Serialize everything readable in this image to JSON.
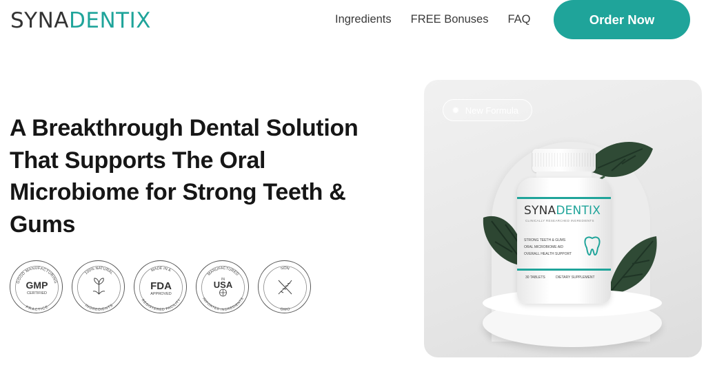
{
  "brand": {
    "name_part1": "SYNA",
    "name_part2": "DENTIX"
  },
  "nav": {
    "items": [
      {
        "label": "Ingredients"
      },
      {
        "label": "FREE Bonuses"
      },
      {
        "label": "FAQ"
      }
    ],
    "cta_label": "Order Now"
  },
  "hero": {
    "title": "A Breakthrough Dental Solution That Supports The Oral Microbiome for Strong Teeth & Gums"
  },
  "badges": [
    {
      "icon": "gmp-badge-icon",
      "main": "GMP",
      "sub": "CERTIFIED",
      "ring_top": "GOOD MANUFACTURING",
      "ring_bottom": "PRACTICE"
    },
    {
      "icon": "natural-badge-icon",
      "ring_top": "100% NATURAL",
      "ring_bottom": "INGREDIENTS"
    },
    {
      "icon": "fda-badge-icon",
      "main": "FDA",
      "sub": "APPROVED",
      "ring_top": "MADE IN A",
      "ring_bottom": "REGISTERED FACILITY"
    },
    {
      "icon": "usa-badge-icon",
      "top_small": "IN",
      "main": "USA",
      "ring_top": "MANUFACTURED",
      "ring_bottom": "IMPORTED INGREDIENTS"
    },
    {
      "icon": "non-gmo-badge-icon",
      "ring_top": "NON",
      "ring_bottom": "GMO"
    }
  ],
  "product": {
    "pill_label": "New Formula",
    "label_brand_part1": "SYNA",
    "label_brand_part2": "DENTIX",
    "label_subtitle": "CLINICALLY RESEARCHED INGREDIENTS",
    "label_bullets": [
      "STRONG TEETH & GUMS",
      "ORAL MICROBIOME AID",
      "OVERALL HEALTH SUPPORT"
    ],
    "label_footer_left": "30 TABLETS",
    "label_footer_right": "DIETARY SUPPLEMENT"
  },
  "colors": {
    "accent": "#1fa49a",
    "text": "#161616"
  }
}
